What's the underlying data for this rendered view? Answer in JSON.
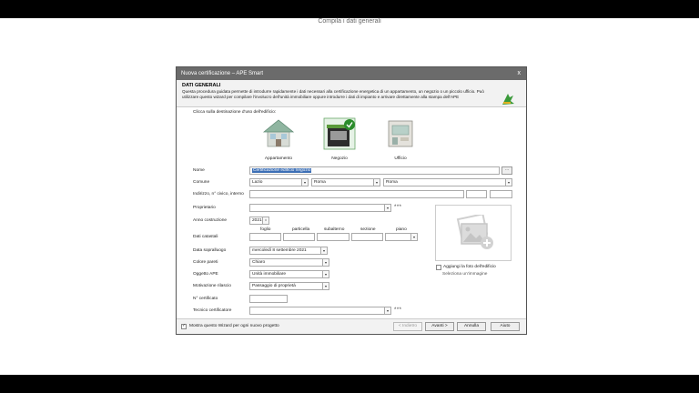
{
  "app": {
    "title": "Compila i dati generali"
  },
  "dialog": {
    "title": "Nuova certificazione – APE Smart",
    "close": "x",
    "header_title": "DATI GENERALI",
    "header_desc": "Questa procedura guidata permette di introdurre rapidamente i dati necessari alla certificazione energetica di un appartamento, un negozio o un piccolo ufficio. Può utilizzare questo wizard per compilare l'involucro dell'unità immobiliare oppure introdurre i dati di impianto e arrivare direttamente alla stampa dell'APE"
  },
  "destination": {
    "prompt": "Clicca sulla destinazione d'uso dell'edificio:",
    "options": [
      {
        "label": "Appartamento"
      },
      {
        "label": "Negozio"
      },
      {
        "label": "Ufficio"
      }
    ]
  },
  "form": {
    "nome_label": "Nome",
    "nome_value": "Certificazione edificio negozio",
    "comune_label": "Comune",
    "regione": "Lazio",
    "provincia": "Roma",
    "comune": "Roma",
    "indirizzo_label": "Indirizzo, n° civico, interno",
    "proprietario_label": "Proprietario",
    "anno_label": "Anno costruzione",
    "anno_value": "2021",
    "catastali_label": "Dati catastali",
    "cat_foglio": "foglio",
    "cat_particella": "particella",
    "cat_subalterno": "subalterno",
    "cat_sezione": "sezione",
    "cat_piano": "piano",
    "data_label": "Data sopralluogo",
    "data_value": "mercoledì   8 settembre 2021",
    "colore_label": "Colore pareti",
    "colore_value": "Chiaro",
    "oggetto_label": "Oggetto APE",
    "oggetto_value": "Unità immobiliare",
    "motivazione_label": "Motivazione rilascio",
    "motivazione_value": "Passaggio di proprietà",
    "ncert_label": "N° certificato",
    "tecnico_label": "Tecnico certificatore",
    "dots": "***",
    "browse": "..."
  },
  "photo": {
    "add_label": "Aggiungi la foto dell'edificio",
    "select_label": "Seleziona un'immagine"
  },
  "footer": {
    "wizard_check_label": "Mostra questo Wizard per ogni nuovo progetto",
    "back": "< Indietro",
    "next": "Avanti >",
    "cancel": "Annulla",
    "help": "Aiuto"
  },
  "colors": {
    "accent": "#2a8c2a",
    "selection": "#3d6fb5",
    "titlebar": "#6b6b6b"
  }
}
